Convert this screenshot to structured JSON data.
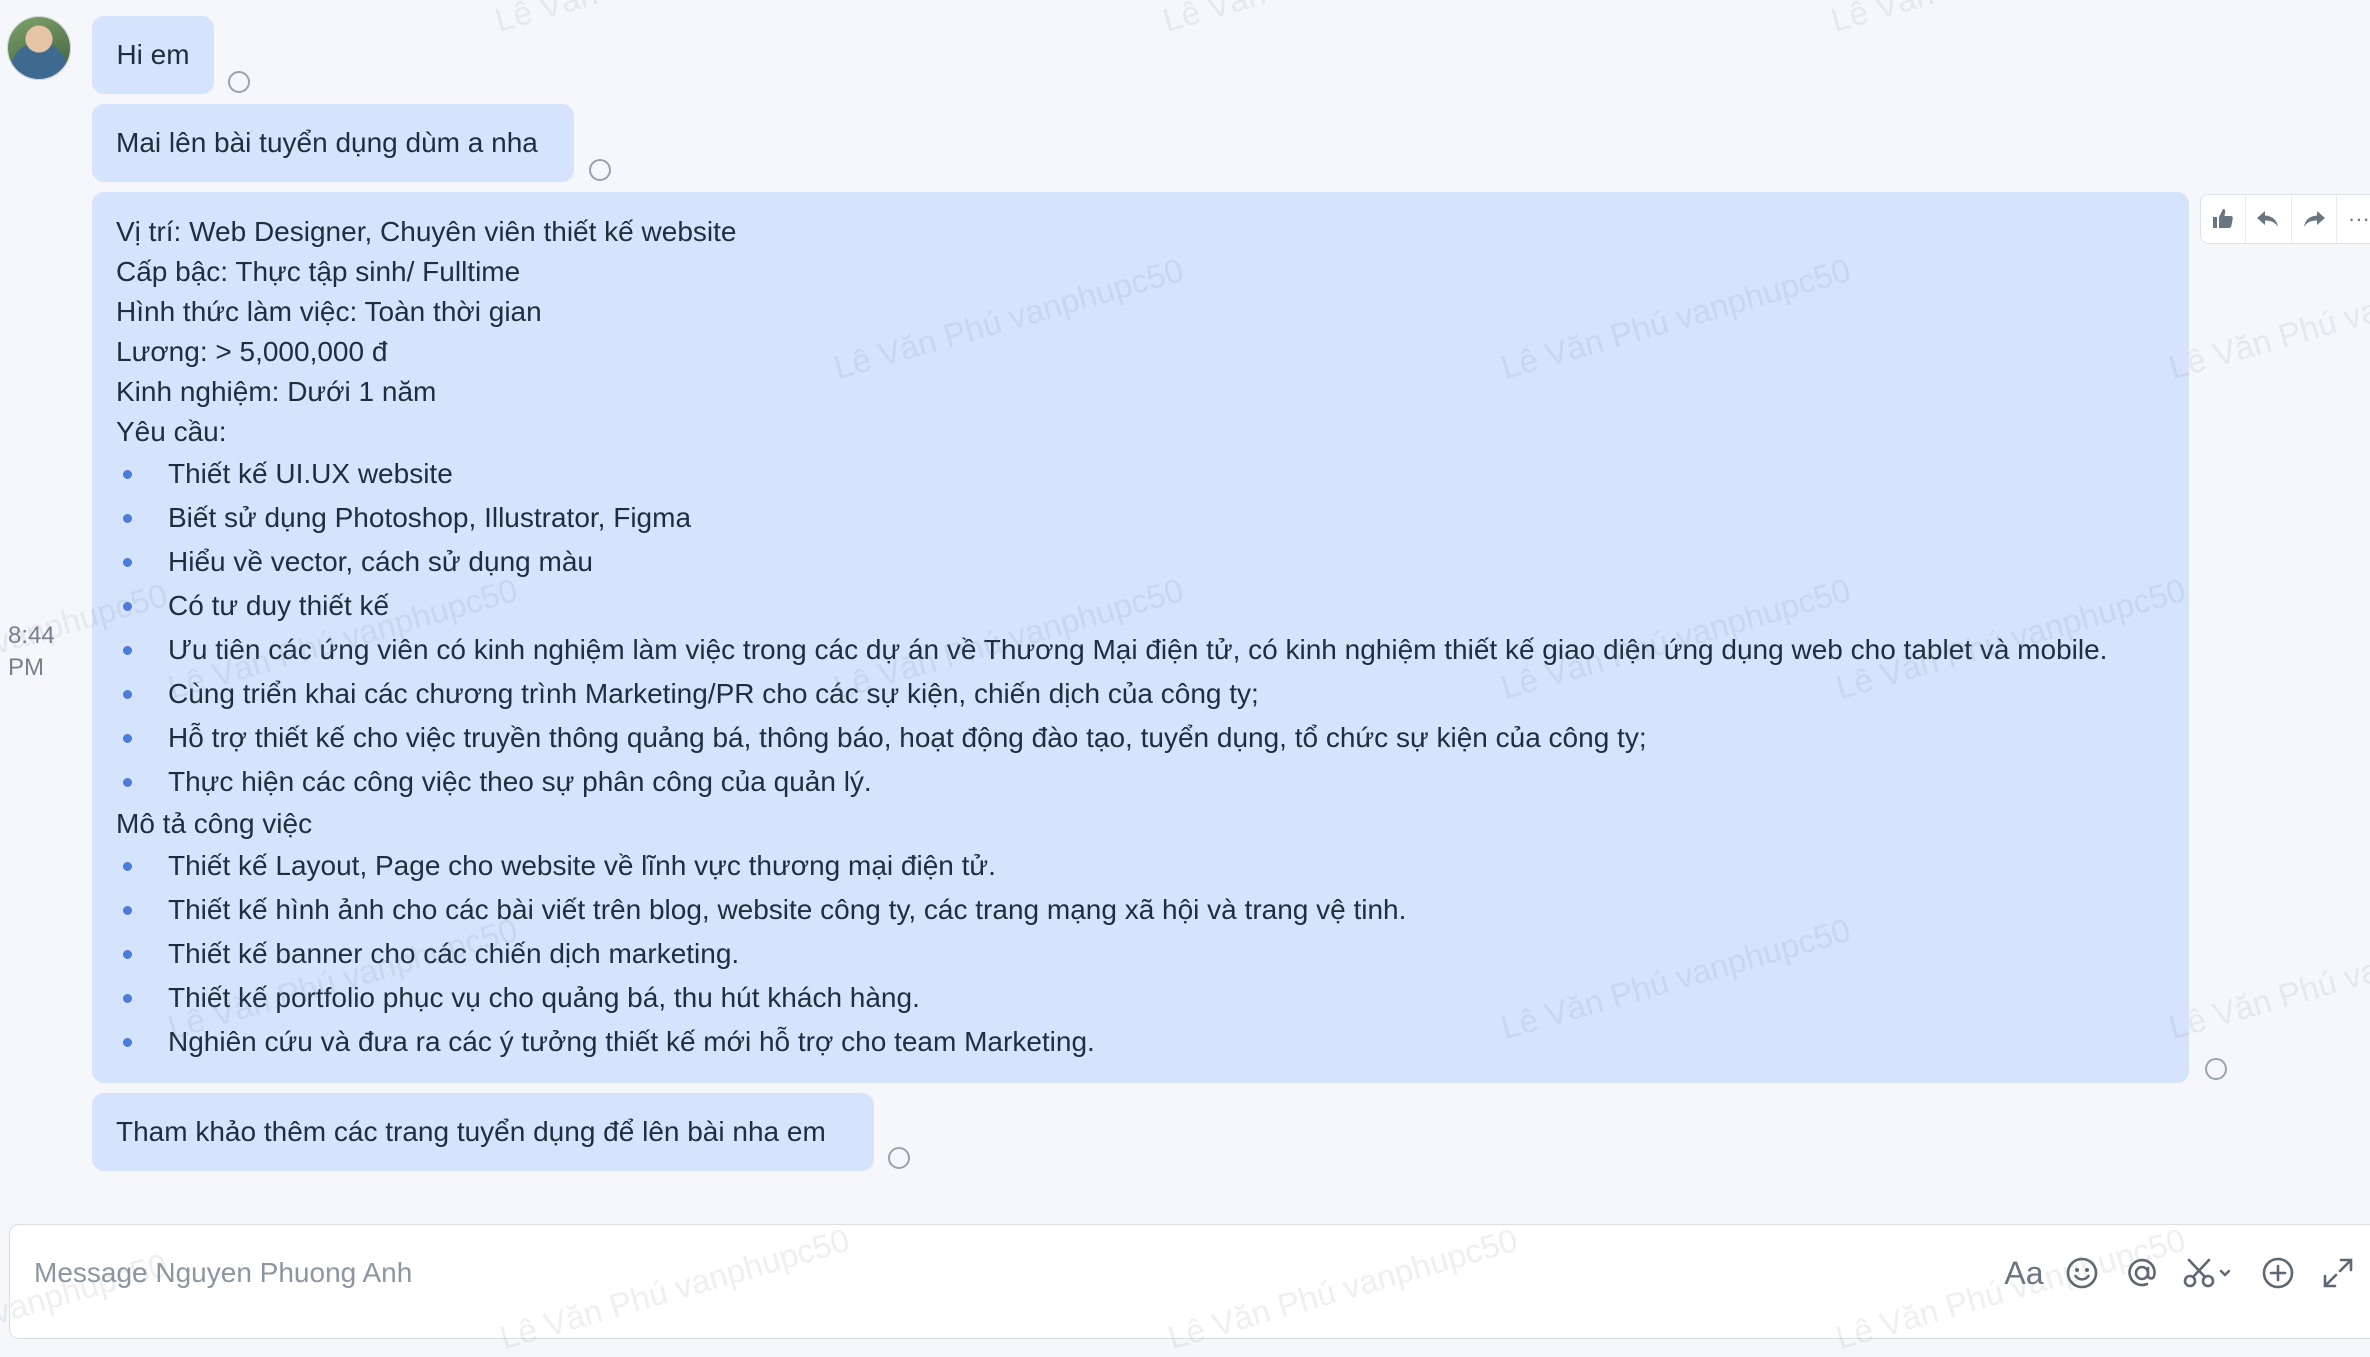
{
  "conversation": {
    "messages": [
      {
        "text": "Hi em"
      },
      {
        "text": "Mai lên bài tuyển dụng dùm a nha"
      },
      {
        "lines_intro": [
          "Vị trí: Web Designer, Chuyên viên  thiết kế website",
          "Cấp bậc: Thực tập sinh/ Fulltime",
          "Hình thức làm việc: Toàn thời gian",
          "Lương: > 5,000,000 đ",
          "Kinh nghiệm: Dưới 1 năm",
          "Yêu cầu:"
        ],
        "requirements": [
          "Thiết kế UI.UX website",
          "Biết sử dụng Photoshop, Illustrator, Figma",
          "Hiểu về vector, cách sử dụng màu",
          "Có tư duy thiết kế",
          "Ưu tiên các ứng viên có kinh nghiệm làm việc trong các dự án về Thương Mại điện tử, có kinh nghiệm thiết kế giao diện ứng dụng web cho tablet và mobile.",
          "Cùng triển khai các chương trình Marketing/PR cho các sự kiện, chiến dịch của công ty;",
          "Hỗ trợ thiết kế cho việc truyền thông quảng bá, thông báo, hoạt động đào tạo, tuyển dụng, tổ chức sự kiện của công ty;",
          "Thực hiện các công việc theo sự phân công của quản lý."
        ],
        "description_heading": "Mô tả công việc",
        "description": [
          "Thiết kế Layout, Page cho website về lĩnh vực thương mại điện tử.",
          "Thiết kế hình ảnh cho các bài viết trên blog, website công ty, các trang mạng xã hội và trang vệ tinh.",
          "Thiết kế banner cho các chiến dịch marketing.",
          "Thiết kế portfolio phục vụ cho quảng bá, thu hút khách hàng.",
          "Nghiên cứu và đưa ra các ý tưởng thiết kế mới hỗ trợ cho team Marketing."
        ]
      },
      {
        "text": "Tham khảo thêm các trang tuyển dụng để lên bài nha em"
      }
    ],
    "timestamp_time": "8:44",
    "timestamp_period": "PM"
  },
  "actions": {
    "icons": [
      "thumbs-up-icon",
      "reply-icon",
      "forward-icon",
      "more-icon"
    ],
    "more_label": "···"
  },
  "composer": {
    "placeholder": "Message Nguyen Phuong Anh",
    "format_label": "Aa",
    "icons": [
      "format-text-icon",
      "emoji-icon",
      "mention-icon",
      "screenshot-icon",
      "add-icon",
      "expand-icon"
    ]
  },
  "watermark": {
    "text": "Lê Văn Phú vanphupc50",
    "short": "Lê Văn",
    "partial": "vanphupc50"
  },
  "colors": {
    "bubble": "#d5e3fd",
    "bullet": "#4a7ddb",
    "background": "#f5f7fa"
  }
}
